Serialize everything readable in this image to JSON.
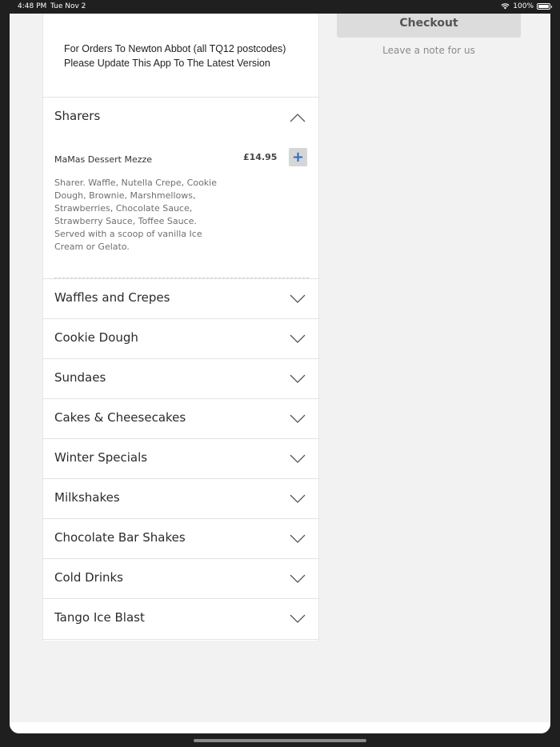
{
  "status_bar": {
    "time": "4:48 PM",
    "date": "Tue Nov 2",
    "battery": "100%"
  },
  "notice": {
    "line1": "For Orders To Newton Abbot (all TQ12 postcodes)",
    "line2": "Please Update This App To The Latest Version"
  },
  "sections": [
    {
      "label": "Sharers",
      "expanded": true
    },
    {
      "label": "Waffles and Crepes",
      "expanded": false
    },
    {
      "label": "Cookie Dough",
      "expanded": false
    },
    {
      "label": "Sundaes",
      "expanded": false
    },
    {
      "label": "Cakes & Cheesecakes",
      "expanded": false
    },
    {
      "label": "Winter Specials",
      "expanded": false
    },
    {
      "label": "Milkshakes",
      "expanded": false
    },
    {
      "label": "Chocolate Bar Shakes",
      "expanded": false
    },
    {
      "label": "Cold Drinks",
      "expanded": false
    },
    {
      "label": "Tango Ice Blast",
      "expanded": false
    }
  ],
  "item": {
    "name": "MaMas Dessert Mezze",
    "price": "£14.95",
    "add_label": "+",
    "description": "Sharer. Waffle, Nutella Crepe, Cookie Dough, Brownie, Marshmellows, Strawberries, Chocolate Sauce, Strawberry Sauce, Toffee Sauce. Served with a scoop of vanilla Ice Cream or Gelato."
  },
  "cart": {
    "checkout_label": "Checkout",
    "note_label": "Leave a note for us"
  },
  "colors": {
    "accent": "#2a6fbf",
    "sheet_bg": "#f2f2f2",
    "panel_bg": "#ffffff"
  }
}
